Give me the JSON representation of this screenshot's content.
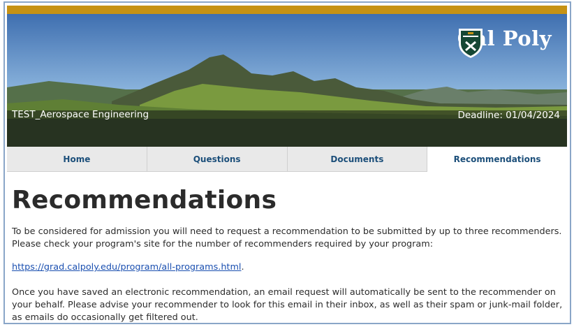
{
  "header": {
    "brand_name": "Cal Poly",
    "program_name": "TEST_Aerospace Engineering",
    "deadline": "Deadline: 01/04/2024",
    "colors": {
      "gold": "#c69214",
      "brand_green": "#154734",
      "tab_text": "#1c4f7a"
    }
  },
  "tabs": [
    {
      "label": "Home",
      "active": false
    },
    {
      "label": "Questions",
      "active": false
    },
    {
      "label": "Documents",
      "active": false
    },
    {
      "label": "Recommendations",
      "active": true
    }
  ],
  "main": {
    "title": "Recommendations",
    "intro": "To be considered for admission you will need to request a recommendation to be submitted by up to three recommenders.  Please check your program's site for the number of recommenders required by your program:",
    "link_text": "https://grad.calpoly.edu/program/all-programs.html",
    "link_suffix": ".",
    "note": "Once you have saved an electronic recommendation, an email request will automatically be sent to the recommender on your behalf. Please advise your recommender to look for this email in their inbox, as well as their spam or junk-mail folder, as emails do occasionally get filtered out."
  }
}
